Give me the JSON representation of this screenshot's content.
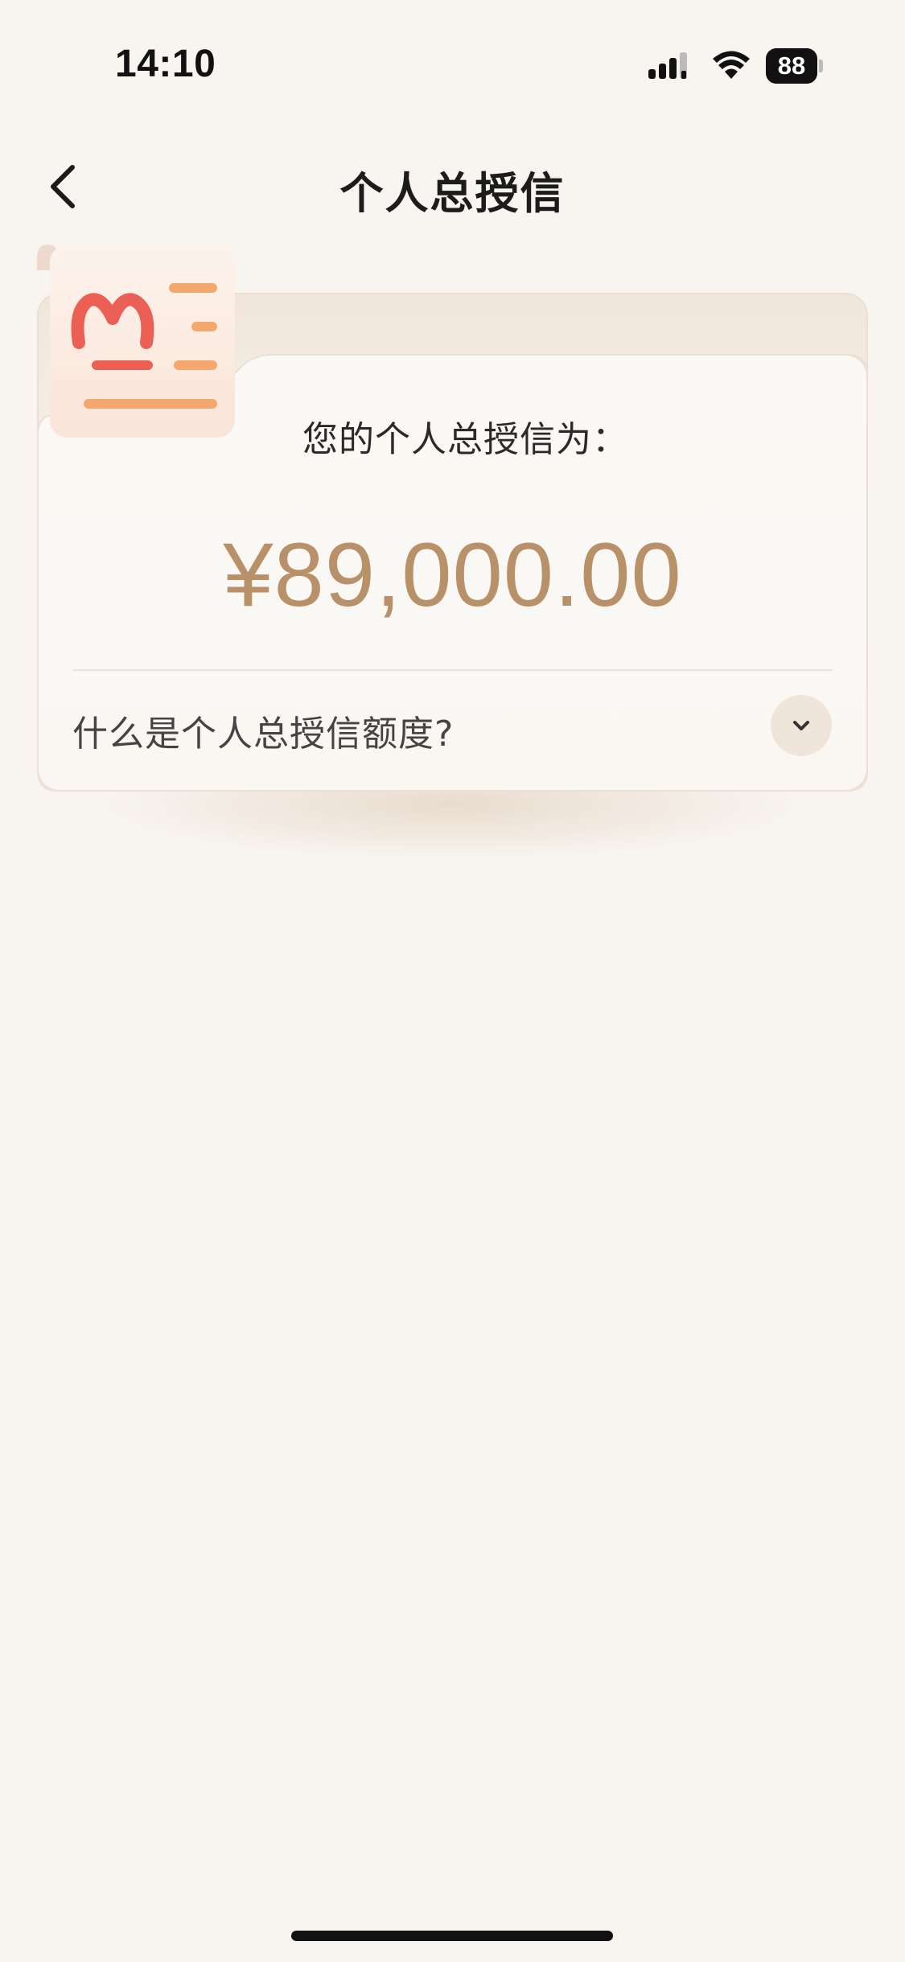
{
  "status_bar": {
    "time": "14:10",
    "battery_level": "88",
    "signal_icon": "cellular-signal-icon",
    "wifi_icon": "wifi-icon",
    "battery_icon": "battery-icon"
  },
  "nav": {
    "title": "个人总授信",
    "back_icon": "chevron-left-icon"
  },
  "card": {
    "label": "您的个人总授信为：",
    "amount": "¥89,000.00",
    "faq_question": "什么是个人总授信额度?",
    "faq_toggle_icon": "chevron-down-icon",
    "illustration_icon": "document-icon"
  },
  "colors": {
    "background": "#f8f4f0",
    "amount": "#b89168",
    "doc_logo": "#ec5f55",
    "doc_lines": "#f4a86e"
  }
}
